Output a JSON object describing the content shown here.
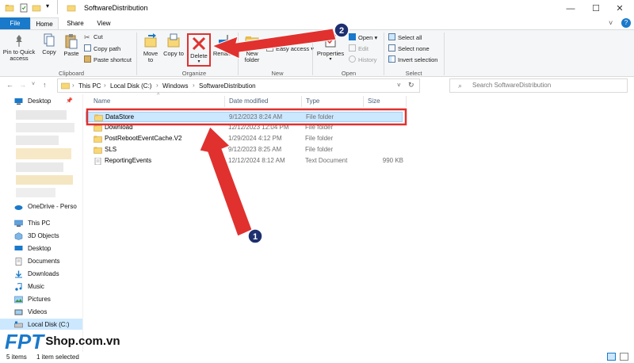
{
  "window": {
    "title": "SoftwareDistribution",
    "buttons": {
      "minimize": "—",
      "maximize": "☐",
      "close": "✕"
    }
  },
  "tabs": [
    "File",
    "Home",
    "Share",
    "View"
  ],
  "ribbon": {
    "clipboard": {
      "pin_label": "Pin to Quick access",
      "copy_label": "Copy",
      "paste_label": "Paste",
      "cut_label": "Cut",
      "copy_path_label": "Copy path",
      "paste_shortcut_label": "Paste shortcut",
      "group_label": "Clipboard"
    },
    "organize": {
      "move_to_label": "Move to",
      "copy_to_label": "Copy to",
      "delete_label": "Delete",
      "rename_label": "Rename",
      "group_label": "Organize"
    },
    "new": {
      "new_folder_label": "New folder",
      "easy_access_label": "Easy access",
      "group_label": "New"
    },
    "open": {
      "properties_label": "Properties",
      "open_label": "Open",
      "edit_label": "Edit",
      "history_label": "History",
      "group_label": "Open"
    },
    "select": {
      "select_all_label": "Select all",
      "select_none_label": "Select none",
      "invert_label": "Invert selection",
      "group_label": "Select"
    }
  },
  "address": {
    "crumbs": [
      "This PC",
      "Local Disk (C:)",
      "Windows",
      "SoftwareDistribution"
    ],
    "search_placeholder": "Search SoftwareDistribution"
  },
  "nav": {
    "desktop_pinned": "Desktop",
    "onedrive": "OneDrive - Perso",
    "this_pc": "This PC",
    "items": [
      "3D Objects",
      "Desktop",
      "Documents",
      "Downloads",
      "Music",
      "Pictures",
      "Videos",
      "Local Disk (C:)"
    ]
  },
  "columns": {
    "name": "Name",
    "date": "Date modified",
    "type": "Type",
    "size": "Size"
  },
  "files": [
    {
      "name": "DataStore",
      "date": "9/12/2023 8:24 AM",
      "type": "File folder",
      "size": ""
    },
    {
      "name": "Download",
      "date": "12/12/2023 12:04 PM",
      "type": "File folder",
      "size": ""
    },
    {
      "name": "PostRebootEventCache.V2",
      "date": "1/29/2024 4:12 PM",
      "type": "File folder",
      "size": ""
    },
    {
      "name": "SLS",
      "date": "9/12/2023 8:25 AM",
      "type": "File folder",
      "size": ""
    },
    {
      "name": "ReportingEvents",
      "date": "12/12/2024 8:12 AM",
      "type": "Text Document",
      "size": "990 KB"
    }
  ],
  "status": {
    "count": "5 items",
    "selected": "1 item selected"
  },
  "annotations": {
    "step1": "1",
    "step2": "2"
  },
  "watermark": {
    "brand": "FPT",
    "site": "Shop.com.vn"
  },
  "colors": {
    "accent": "#1979ca",
    "highlight": "#e0312f",
    "selection": "#cce8ff",
    "folder": "#f8d775"
  }
}
